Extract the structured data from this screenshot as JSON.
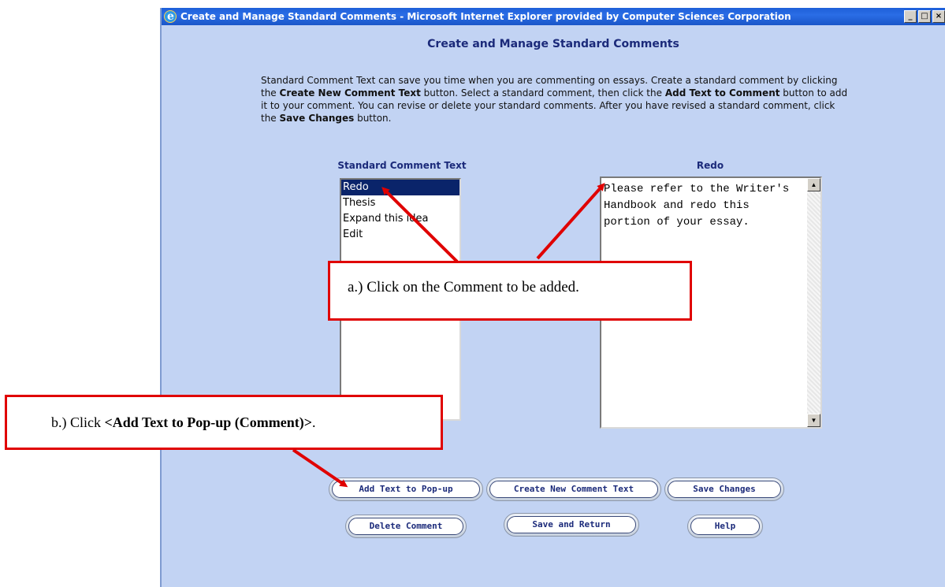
{
  "window": {
    "title": "Create and Manage Standard Comments - Microsoft Internet Explorer provided by Computer Sciences Corporation",
    "controls": {
      "minimize": "_",
      "maximize": "□",
      "close": "×"
    }
  },
  "page": {
    "title": "Create and Manage Standard Comments",
    "intro": {
      "p1": "Standard Comment Text can save you time when you are commenting on essays. Create a standard comment by clicking the ",
      "b1": "Create New Comment Text",
      "p2": " button. Select a standard comment, then click the ",
      "b2": "Add Text to Comment",
      "p3": " button to add it to your comment. You can revise or delete your standard comments. After you have revised a standard comment, click the ",
      "b3": "Save Changes",
      "p4": " button."
    }
  },
  "list": {
    "header": "Standard Comment Text",
    "items": [
      "Redo",
      "Thesis",
      "Expand this idea",
      "Edit"
    ],
    "selected": "Redo"
  },
  "editor": {
    "header": "Redo",
    "text": "Please refer to the Writer's Handbook and redo this portion of your essay."
  },
  "buttons": {
    "add_text": "Add Text to Pop-up",
    "create_new": "Create New Comment Text",
    "save_changes": "Save Changes",
    "delete_comment": "Delete Comment",
    "save_return": "Save and Return",
    "help": "Help"
  },
  "callouts": {
    "a": "a.) Click on the Comment to be added.",
    "b_prefix": "b.) Click ",
    "b_bold": "<Add Text to Pop-up (Comment)>",
    "b_suffix": "."
  },
  "colors": {
    "annotation": "#e00000",
    "page_bg": "#c2d3f3",
    "titlebar": "#2a6de6",
    "selection": "#0a246a"
  }
}
